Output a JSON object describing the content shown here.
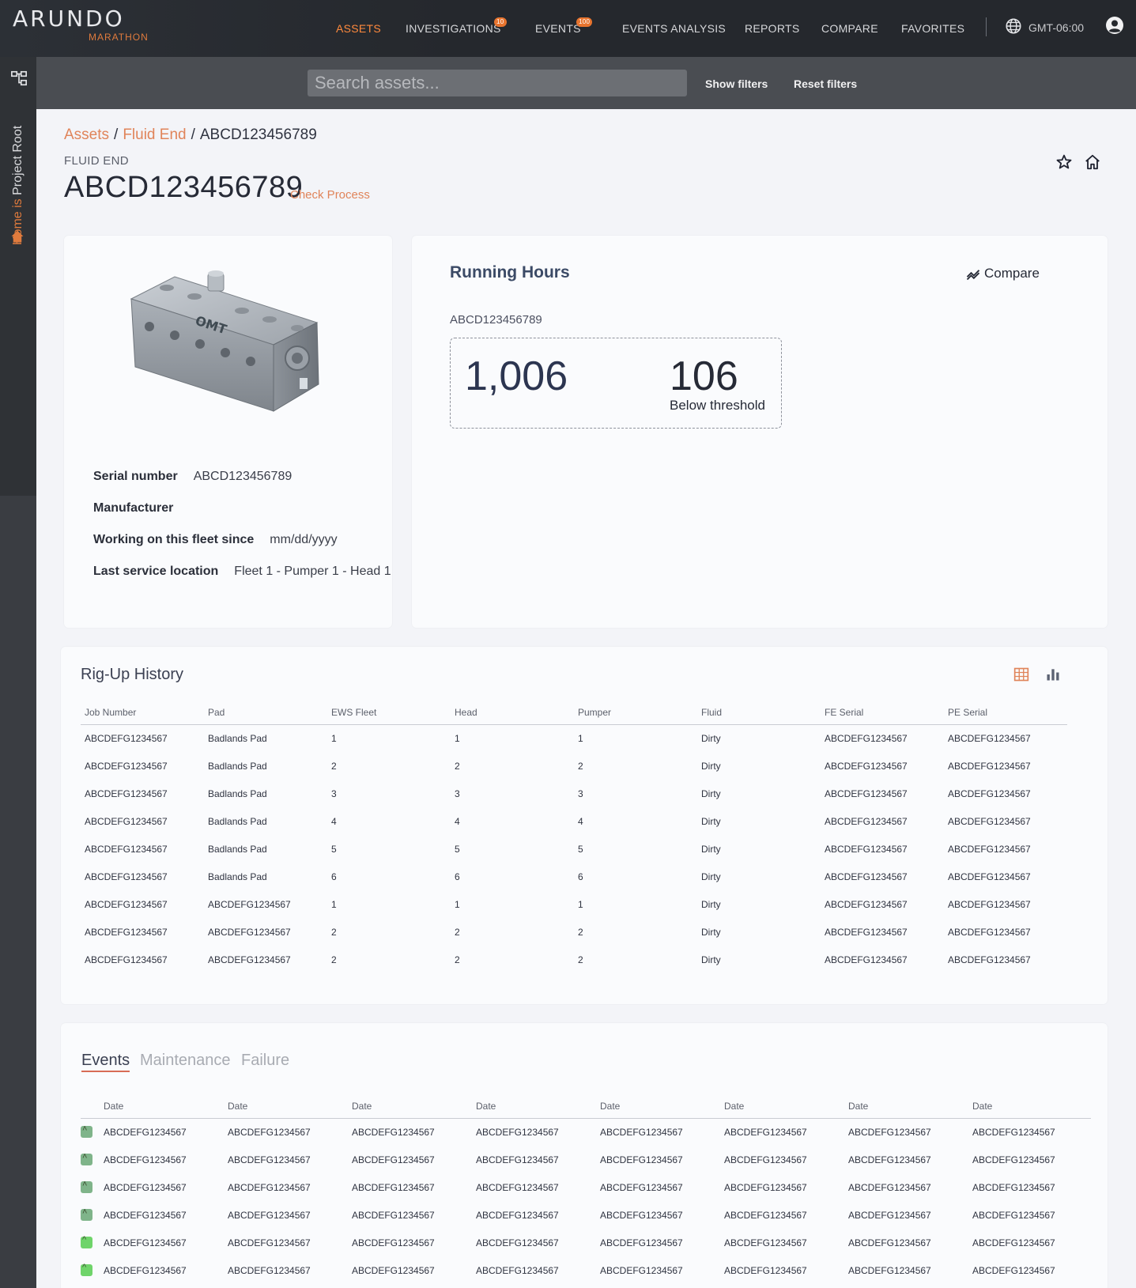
{
  "app": {
    "logo_main": "ARUNDO",
    "logo_sub": "MARATHON"
  },
  "nav": {
    "items": [
      {
        "label": "ASSETS",
        "active": true
      },
      {
        "label": "INVESTIGATIONS",
        "badge": "10"
      },
      {
        "label": "EVENTS",
        "badge": "100"
      },
      {
        "label": "EVENTS ANALYSIS"
      },
      {
        "label": "REPORTS"
      },
      {
        "label": "COMPARE"
      },
      {
        "label": "FAVORITES"
      }
    ],
    "timezone": "GMT-06:00"
  },
  "rail": {
    "home_prefix": "Home is",
    "root_label": "Project Root"
  },
  "search": {
    "placeholder": "Search assets...",
    "show_filters": "Show filters",
    "reset_filters": "Reset filters"
  },
  "breadcrumb": {
    "assets": "Assets",
    "fluid_end": "Fluid End",
    "current": "ABCD123456789",
    "sep": "/"
  },
  "asset": {
    "type": "FLUID END",
    "title": "ABCD123456789",
    "check_process": "Check Process",
    "props": {
      "serial_label": "Serial number",
      "serial_value": "ABCD123456789",
      "manufacturer_label": "Manufacturer",
      "manufacturer_value": "",
      "fleet_since_label": "Working on this fleet since",
      "fleet_since_value": "mm/dd/yyyy",
      "last_service_label": "Last service location",
      "last_service_value": "Fleet 1 - Pumper 1 - Head 1"
    },
    "image_label": "OMT"
  },
  "running_hours": {
    "title": "Running Hours",
    "compare": "Compare",
    "asset_id": "ABCD123456789",
    "hours": "1,006",
    "remaining": "106",
    "remaining_label": "Below threshold"
  },
  "rigup": {
    "title": "Rig-Up History",
    "columns": [
      "Job Number",
      "Pad",
      "EWS Fleet",
      "Head",
      "Pumper",
      "Fluid",
      "FE Serial",
      "PE Serial"
    ],
    "rows": [
      [
        "ABCDEFG1234567",
        "Badlands Pad",
        "1",
        "1",
        "1",
        "Dirty",
        "ABCDEFG1234567",
        "ABCDEFG1234567"
      ],
      [
        "ABCDEFG1234567",
        "Badlands Pad",
        "2",
        "2",
        "2",
        "Dirty",
        "ABCDEFG1234567",
        "ABCDEFG1234567"
      ],
      [
        "ABCDEFG1234567",
        "Badlands Pad",
        "3",
        "3",
        "3",
        "Dirty",
        "ABCDEFG1234567",
        "ABCDEFG1234567"
      ],
      [
        "ABCDEFG1234567",
        "Badlands Pad",
        "4",
        "4",
        "4",
        "Dirty",
        "ABCDEFG1234567",
        "ABCDEFG1234567"
      ],
      [
        "ABCDEFG1234567",
        "Badlands Pad",
        "5",
        "5",
        "5",
        "Dirty",
        "ABCDEFG1234567",
        "ABCDEFG1234567"
      ],
      [
        "ABCDEFG1234567",
        "Badlands Pad",
        "6",
        "6",
        "6",
        "Dirty",
        "ABCDEFG1234567",
        "ABCDEFG1234567"
      ],
      [
        "ABCDEFG1234567",
        "ABCDEFG1234567",
        "1",
        "1",
        "1",
        "Dirty",
        "ABCDEFG1234567",
        "ABCDEFG1234567"
      ],
      [
        "ABCDEFG1234567",
        "ABCDEFG1234567",
        "2",
        "2",
        "2",
        "Dirty",
        "ABCDEFG1234567",
        "ABCDEFG1234567"
      ],
      [
        "ABCDEFG1234567",
        "ABCDEFG1234567",
        "2",
        "2",
        "2",
        "Dirty",
        "ABCDEFG1234567",
        "ABCDEFG1234567"
      ]
    ]
  },
  "events": {
    "tabs": [
      "Events",
      "Maintenance",
      "Failure"
    ],
    "columns": [
      "Date",
      "Date",
      "Date",
      "Date",
      "Date",
      "Date",
      "Date",
      "Date"
    ],
    "rows": [
      {
        "priority": "high",
        "cells": [
          "ABCDEFG1234567",
          "ABCDEFG1234567",
          "ABCDEFG1234567",
          "ABCDEFG1234567",
          "ABCDEFG1234567",
          "ABCDEFG1234567",
          "ABCDEFG1234567",
          "ABCDEFG1234567"
        ]
      },
      {
        "priority": "high",
        "cells": [
          "ABCDEFG1234567",
          "ABCDEFG1234567",
          "ABCDEFG1234567",
          "ABCDEFG1234567",
          "ABCDEFG1234567",
          "ABCDEFG1234567",
          "ABCDEFG1234567",
          "ABCDEFG1234567"
        ]
      },
      {
        "priority": "high",
        "cells": [
          "ABCDEFG1234567",
          "ABCDEFG1234567",
          "ABCDEFG1234567",
          "ABCDEFG1234567",
          "ABCDEFG1234567",
          "ABCDEFG1234567",
          "ABCDEFG1234567",
          "ABCDEFG1234567"
        ]
      },
      {
        "priority": "high",
        "cells": [
          "ABCDEFG1234567",
          "ABCDEFG1234567",
          "ABCDEFG1234567",
          "ABCDEFG1234567",
          "ABCDEFG1234567",
          "ABCDEFG1234567",
          "ABCDEFG1234567",
          "ABCDEFG1234567"
        ]
      },
      {
        "priority": "medium",
        "cells": [
          "ABCDEFG1234567",
          "ABCDEFG1234567",
          "ABCDEFG1234567",
          "ABCDEFG1234567",
          "ABCDEFG1234567",
          "ABCDEFG1234567",
          "ABCDEFG1234567",
          "ABCDEFG1234567"
        ]
      },
      {
        "priority": "medium",
        "cells": [
          "ABCDEFG1234567",
          "ABCDEFG1234567",
          "ABCDEFG1234567",
          "ABCDEFG1234567",
          "ABCDEFG1234567",
          "ABCDEFG1234567",
          "ABCDEFG1234567",
          "ABCDEFG1234567"
        ]
      }
    ]
  },
  "icons": {
    "tree": "tree-structure-icon",
    "globe": "globe-icon",
    "user": "user-account-icon",
    "star": "star-icon",
    "home": "home-icon",
    "compare": "compare-trend-icon",
    "grid": "table-view-icon",
    "bar": "bar-chart-view-icon"
  },
  "colors": {
    "accent": "#e07b3d",
    "topbar": "#25282d",
    "rail": "#3a3d42",
    "badge": "#e8742e"
  }
}
